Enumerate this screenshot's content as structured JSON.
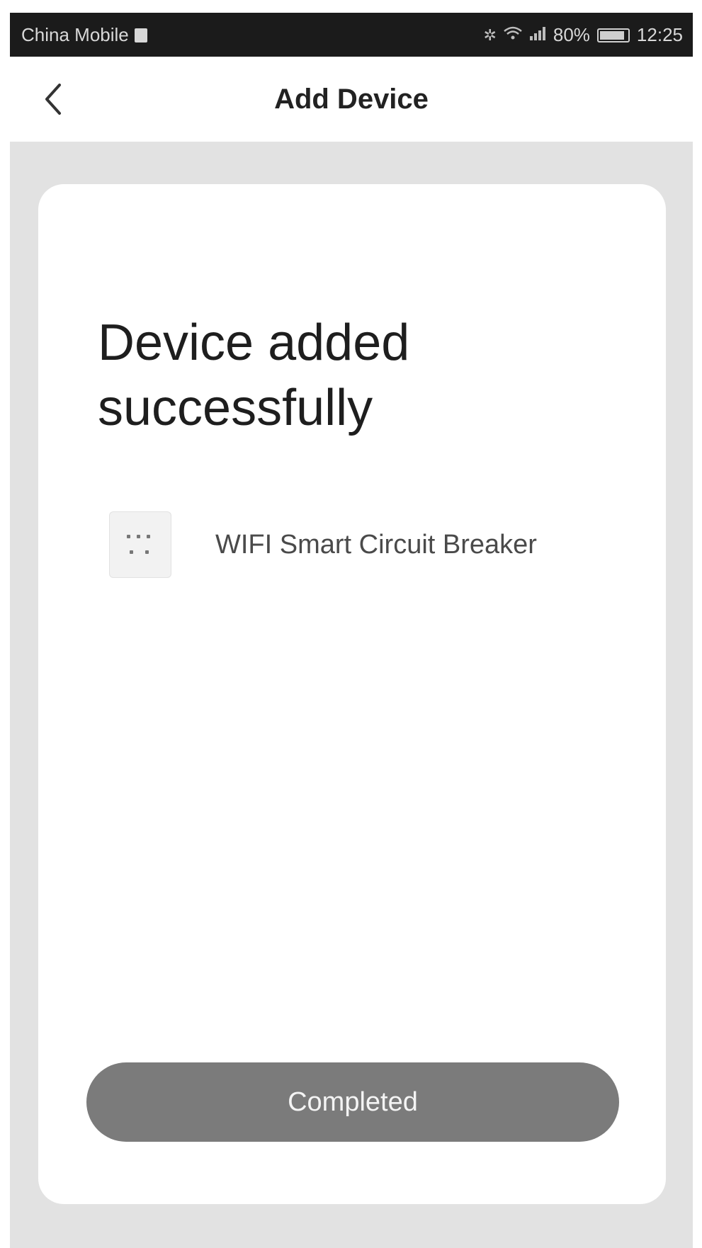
{
  "status_bar": {
    "carrier": "China Mobile",
    "battery_percent": "80%",
    "time": "12:25"
  },
  "nav": {
    "title": "Add Device"
  },
  "main": {
    "success_title": "Device added successfully",
    "device_name": "WIFI Smart Circuit Breaker",
    "completed_label": "Completed"
  },
  "colors": {
    "status_bar_bg": "#1b1b1b",
    "page_bg": "#e2e2e2",
    "button_bg": "#7b7b7b"
  },
  "icons": {
    "back": "chevron-left-icon",
    "device": "circuit-breaker-thumbnail",
    "wifi": "wifi-icon",
    "signal": "signal-icon",
    "battery": "battery-icon"
  }
}
